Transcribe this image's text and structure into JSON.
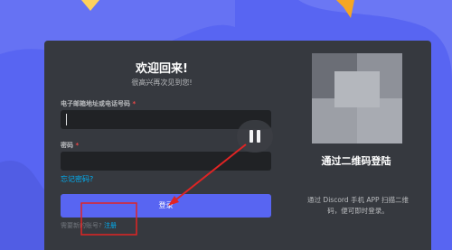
{
  "colors": {
    "background": "#5865f2",
    "modal": "#36393f",
    "input": "#202225",
    "button": "#5865f2",
    "link": "#00b0f4",
    "required": "#f04747",
    "annotation": "#e02424"
  },
  "login": {
    "title": "欢迎回来!",
    "subtitle": "很高兴再次见到您!",
    "email_label": "电子邮箱地址或电话号码",
    "email_value": "",
    "password_label": "密码",
    "password_value": "",
    "required_mark": "*",
    "forgot_link": "忘记密码?",
    "login_button": "登录",
    "register_prompt": "需要新的账号?",
    "register_link": "注册"
  },
  "qr": {
    "title": "通过二维码登陆",
    "description_line1": "通过 Discord 手机 APP 扫描二维",
    "description_line2": "码，便可即时登录。"
  },
  "overlay": {
    "pause_icon": "pause-icon"
  }
}
